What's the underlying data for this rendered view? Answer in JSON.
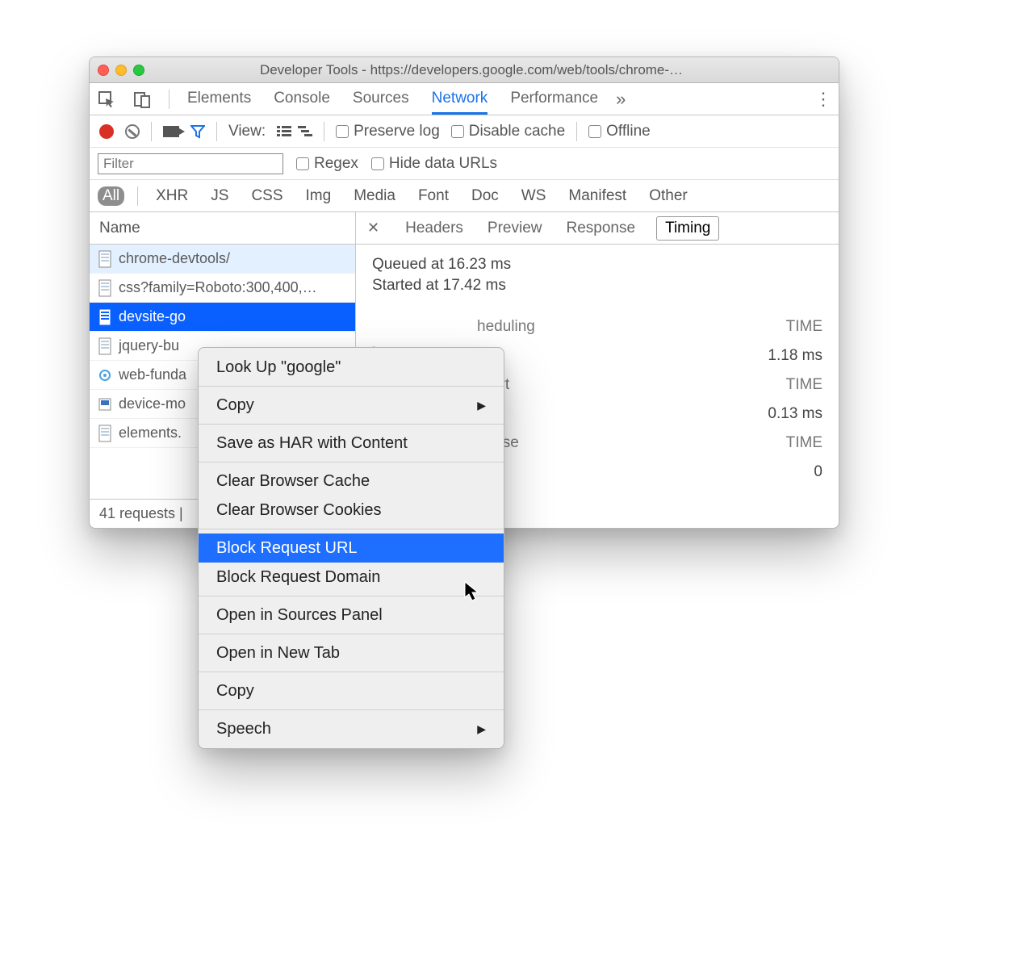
{
  "window": {
    "title": "Developer Tools - https://developers.google.com/web/tools/chrome-…"
  },
  "tabs": {
    "items": [
      "Elements",
      "Console",
      "Sources",
      "Network",
      "Performance"
    ],
    "active": "Network",
    "overflow_glyph": "»"
  },
  "toolbar": {
    "view_label": "View:",
    "preserve_log": "Preserve log",
    "disable_cache": "Disable cache",
    "offline": "Offline"
  },
  "filter": {
    "placeholder": "Filter",
    "regex": "Regex",
    "hide_data_urls": "Hide data URLs"
  },
  "types": {
    "items": [
      "All",
      "XHR",
      "JS",
      "CSS",
      "Img",
      "Media",
      "Font",
      "Doc",
      "WS",
      "Manifest",
      "Other"
    ],
    "active": "All"
  },
  "name_col": {
    "header": "Name"
  },
  "requests": [
    {
      "name": "chrome-devtools/",
      "icon": "doc"
    },
    {
      "name": "css?family=Roboto:300,400,…",
      "icon": "doc"
    },
    {
      "name": "devsite-go",
      "icon": "doc"
    },
    {
      "name": "jquery-bu",
      "icon": "doc"
    },
    {
      "name": "web-funda",
      "icon": "gear"
    },
    {
      "name": "device-mo",
      "icon": "img"
    },
    {
      "name": "elements.",
      "icon": "doc"
    }
  ],
  "status": {
    "text": "41 requests |"
  },
  "detail": {
    "tabs": [
      "Headers",
      "Preview",
      "Response",
      "Timing"
    ],
    "active": "Timing",
    "queued": "Queued at 16.23 ms",
    "started": "Started at 17.42 ms",
    "rows": [
      {
        "label": "heduling",
        "right_head": "TIME",
        "right_val": "1.18 ms"
      },
      {
        "label": "Start",
        "right_head": "TIME",
        "right_val": "0.13 ms"
      },
      {
        "label": "ponse",
        "right_head": "TIME",
        "right_val": "0"
      }
    ]
  },
  "context_menu": {
    "groups": [
      [
        {
          "label": "Look Up \"google\""
        }
      ],
      [
        {
          "label": "Copy",
          "submenu": true
        }
      ],
      [
        {
          "label": "Save as HAR with Content"
        }
      ],
      [
        {
          "label": "Clear Browser Cache"
        },
        {
          "label": "Clear Browser Cookies"
        }
      ],
      [
        {
          "label": "Block Request URL",
          "highlight": true
        },
        {
          "label": "Block Request Domain"
        }
      ],
      [
        {
          "label": "Open in Sources Panel"
        }
      ],
      [
        {
          "label": "Open in New Tab"
        }
      ],
      [
        {
          "label": "Copy"
        }
      ],
      [
        {
          "label": "Speech",
          "submenu": true
        }
      ]
    ]
  }
}
